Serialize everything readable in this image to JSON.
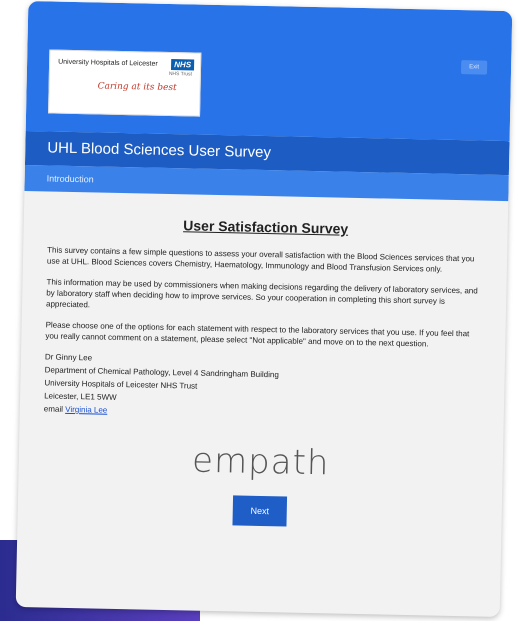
{
  "header": {
    "logo": {
      "name": "University Hospitals of Leicester",
      "nhs": "NHS",
      "trust": "NHS Trust",
      "tagline": "Caring at its best"
    },
    "exit_label": "Exit"
  },
  "title": "UHL Blood Sciences User Survey",
  "section": "Introduction",
  "heading": "User Satisfaction Survey",
  "paragraphs": [
    "This survey contains a few simple questions to assess your overall satisfaction with the Blood Sciences services that you use at UHL. Blood Sciences covers Chemistry, Haematology, Immunology and Blood Transfusion Services only.",
    "This information may be used by commissioners when making decisions regarding the delivery of laboratory services, and by laboratory staff when deciding how to improve services. So your cooperation in completing this short survey is appreciated.",
    "Please choose one of the options for each statement with respect to the laboratory services that you use. If you feel that you really cannot comment on a statement, please select \"Not applicable\" and move on to the next question."
  ],
  "contact": {
    "name": "Dr Ginny Lee",
    "dept": "Department of Chemical Pathology, Level 4 Sandringham Building",
    "org": "University Hospitals of Leicester NHS Trust",
    "address": "Leicester, LE1 5WW",
    "email_prefix": "email",
    "email_link": "Virginia Lee"
  },
  "brand": "empath",
  "next_label": "Next"
}
